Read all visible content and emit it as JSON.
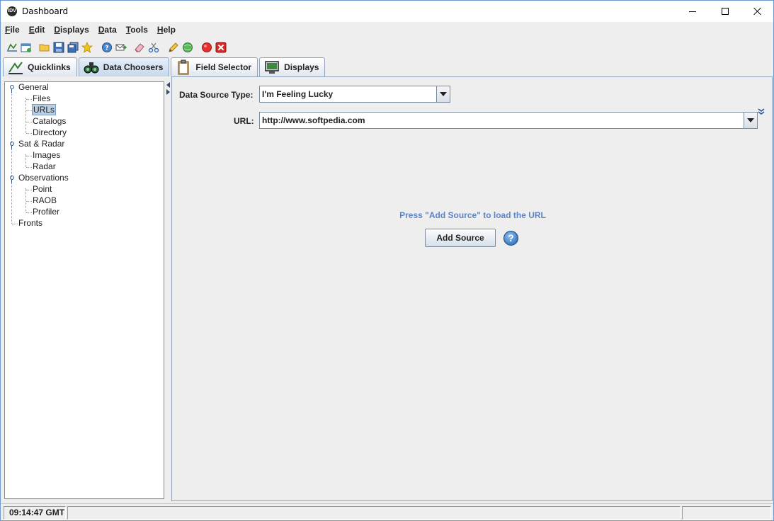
{
  "window": {
    "title": "Dashboard",
    "app_icon_text": "IDV"
  },
  "menu": [
    {
      "key": "F",
      "rest": "ile"
    },
    {
      "key": "E",
      "rest": "dit"
    },
    {
      "key": "D",
      "rest": "isplays"
    },
    {
      "key": "D",
      "rest": "ata"
    },
    {
      "key": "T",
      "rest": "ools"
    },
    {
      "key": "H",
      "rest": "elp"
    }
  ],
  "toolbar_icons": [
    "new-display-icon",
    "new-window-icon",
    "open-folder-icon",
    "save-icon",
    "save-as-icon",
    "favorite-star-icon",
    "help-bubble-icon",
    "send-mail-icon",
    "eraser-icon",
    "scissors-icon",
    "pencil-icon",
    "globe-icon",
    "record-icon",
    "close-red-icon"
  ],
  "tabs": [
    {
      "label": "Quicklinks",
      "icon": "quicklinks-icon"
    },
    {
      "label": "Data Choosers",
      "icon": "binoculars-icon"
    },
    {
      "label": "Field Selector",
      "icon": "clipboard-icon"
    },
    {
      "label": "Displays",
      "icon": "monitor-icon"
    }
  ],
  "tree": {
    "general": "General",
    "files": "Files",
    "urls": "URLs",
    "catalogs": "Catalogs",
    "directory": "Directory",
    "sat_radar": "Sat & Radar",
    "images": "Images",
    "radar": "Radar",
    "observations": "Observations",
    "point": "Point",
    "raob": "RAOB",
    "profiler": "Profiler",
    "fronts": "Fronts"
  },
  "form": {
    "source_type_label": "Data Source Type:",
    "source_type_value": "I'm Feeling Lucky",
    "url_label": "URL:",
    "url_value": "http://www.softpedia.com",
    "hint": "Press \"Add Source\" to load the URL",
    "add_source_label": "Add Source",
    "help_glyph": "?"
  },
  "status": {
    "time": "09:14:47 GMT"
  },
  "colors": {
    "accent": "#5d85c6",
    "selection": "#b8cfe5",
    "record_red": "#e53030"
  }
}
